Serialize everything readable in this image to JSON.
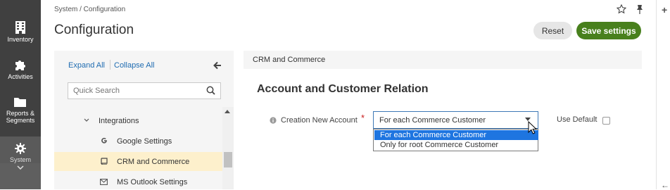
{
  "nav": {
    "items": [
      {
        "label": "Inventory",
        "icon": "building-icon"
      },
      {
        "label": "Activities",
        "icon": "puzzle-icon"
      },
      {
        "label": "Reports &",
        "label2": "Segments",
        "icon": "folder-icon"
      },
      {
        "label": "System",
        "icon": "gear-icon"
      }
    ]
  },
  "header": {
    "breadcrumb": "System / Configuration",
    "title": "Configuration",
    "reset_label": "Reset",
    "save_label": "Save settings"
  },
  "sidebar": {
    "expand_all": "Expand All",
    "collapse_all": "Collapse All",
    "search_placeholder": "Quick Search",
    "items": [
      {
        "label": "Integrations",
        "icon": "chevron-down-icon"
      },
      {
        "label": "Google Settings",
        "icon": "google-icon"
      },
      {
        "label": "CRM and Commerce",
        "icon": "book-icon",
        "active": true
      },
      {
        "label": "MS Outlook Settings",
        "icon": "envelope-icon"
      }
    ]
  },
  "main": {
    "section_header": "CRM and Commerce",
    "section_title": "Account and Customer Relation",
    "field_label": "Creation New Account",
    "required_mark": "*",
    "select_value": "For each Commerce Customer",
    "options": [
      "For each Commerce Customer",
      "Only for root Commerce Customer"
    ],
    "use_default_label": "Use Default"
  },
  "colors": {
    "nav_bg": "#404040",
    "save_button": "#48801d",
    "link": "#1f6cb1",
    "active_row": "#fdf0cc",
    "selected_option": "#1e75e0"
  }
}
